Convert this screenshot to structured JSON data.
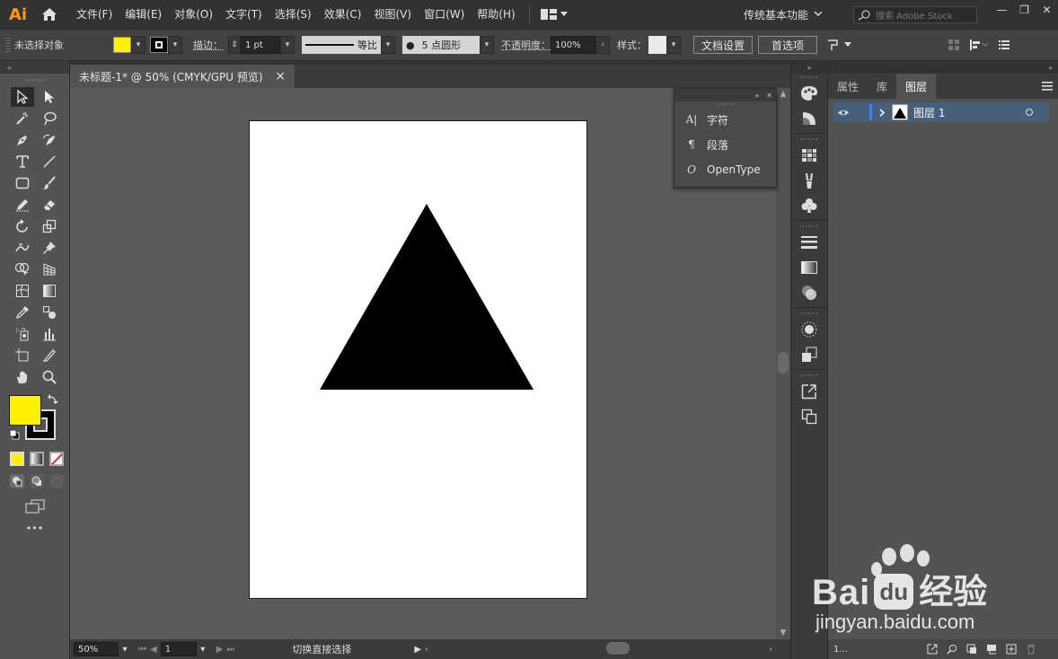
{
  "app": {
    "logo": "Ai"
  },
  "menu": [
    "文件(F)",
    "编辑(E)",
    "对象(O)",
    "文字(T)",
    "选择(S)",
    "效果(C)",
    "视图(V)",
    "窗口(W)",
    "帮助(H)"
  ],
  "workspace": {
    "label": "传统基本功能"
  },
  "search": {
    "placeholder": "搜索 Adobe Stock"
  },
  "window_controls": {
    "minimize": "—",
    "restore": "❐",
    "close": "✕"
  },
  "control_bar": {
    "selection_status": "未选择对象",
    "fill_color": "#ffef00",
    "stroke_label": "描边：",
    "stroke_weight": "1 pt",
    "stroke_profile": "等比",
    "brush": "5 点圆形",
    "opacity_label": "不透明度：",
    "opacity_value": "100%",
    "style_label": "样式：",
    "doc_setup": "文档设置",
    "preferences": "首选项"
  },
  "document": {
    "tab_title": "未标题-1* @ 50% (CMYK/GPU 预览)",
    "tab_close": "×",
    "shape_color": "#000000"
  },
  "tools": {
    "fill_color": "#ffef00",
    "stroke_color": "#000000",
    "more": "•••"
  },
  "character_panel": {
    "items": [
      {
        "label": "字符",
        "icon": "A|"
      },
      {
        "label": "段落",
        "icon": "¶"
      },
      {
        "label": "OpenType",
        "icon": "O"
      }
    ]
  },
  "layers_panel": {
    "tabs": [
      "属性",
      "库",
      "图层"
    ],
    "active_tab": "图层",
    "layer_name": "图层 1",
    "layer_color": "#4a7fdc",
    "footer_count": "1..."
  },
  "status_bar": {
    "zoom": "50%",
    "artboard_number": "1",
    "status_text": "切换直接选择"
  },
  "watermark": {
    "brand_left": "Bai",
    "brand_right": "经验",
    "url": "jingyan.baidu.com"
  }
}
